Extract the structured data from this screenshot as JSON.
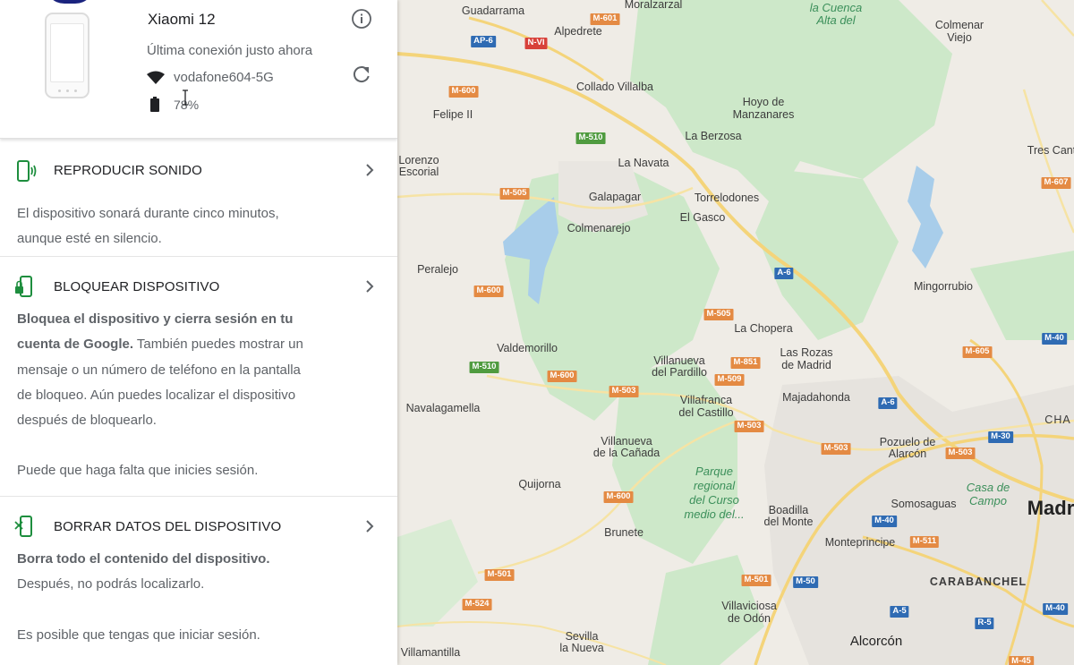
{
  "device": {
    "name": "Xiaomi 12",
    "last_connection": "Última conexión justo ahora",
    "wifi": "vodafone604-5G",
    "battery": "78%"
  },
  "actions": [
    {
      "title": "REPRODUCIR SONIDO",
      "lines": [
        "El dispositivo sonará durante cinco minutos,",
        "aunque esté en silencio."
      ]
    },
    {
      "title": "BLOQUEAR DISPOSITIVO",
      "bold_1": "Bloquea el dispositivo y cierra sesión en tu",
      "bold_2": "cuenta de Google.",
      "text_2": " También puedes mostrar un",
      "line_3": "mensaje o un número de teléfono en la pantalla",
      "line_4": "de bloqueo. Aún puedes localizar el dispositivo",
      "line_5": "después de bloquearlo.",
      "note": "Puede que haga falta que inicies sesión."
    },
    {
      "title": "BORRAR DATOS DEL DISPOSITIVO",
      "bold_1": "Borra todo el contenido del dispositivo.",
      "line_2": "Después, no podrás localizarlo.",
      "note": "Es posible que tengas que iniciar sesión."
    }
  ],
  "map": {
    "places": [
      "Guadarrama",
      "Moralzarzal",
      "Alpedrete",
      "Collado Villalba",
      "Felipe II",
      "Hoyo de",
      "Manzanares",
      "La Berzosa",
      "Tres Cant",
      "Lorenzo",
      "Escorial",
      "La Navata",
      "Galapagar",
      "Torrelodones",
      "Colmenarejo",
      "El Gasco",
      "Peralejo",
      "Mingorrubio",
      "La Chopera",
      "Valdemorillo",
      "Villanueva",
      "del Pardillo",
      "Las Rozas",
      "de Madrid",
      "Villafranca",
      "del Castillo",
      "Majadahonda",
      "Navalagamella",
      "Villanueva",
      "de la Cañada",
      "Pozuelo de",
      "Alarcón",
      "Quijorna",
      "Boadilla",
      "del Monte",
      "Somosaguas",
      "Madr",
      "Brunete",
      "Monteprincipe",
      "CARABANCHEL",
      "Villaviciosa",
      "de Odón",
      "Sevilla",
      "la Nueva",
      "Villamantilla",
      "Alcorcón",
      "Colmenar",
      "Viejo",
      "CHA"
    ],
    "parks": [
      "la Cuenca",
      "Alta del",
      "Parque",
      "regional",
      "del Curso",
      "medio del...",
      "Casa de",
      "Campo"
    ],
    "shields": [
      "M-601",
      "AP-6",
      "N-VI",
      "M-600",
      "M-510",
      "M-505",
      "A-6",
      "M-607",
      "M-600",
      "M-505",
      "M-40",
      "M-851",
      "M-509",
      "M-510",
      "M-600",
      "M-503",
      "M-605",
      "A-6",
      "M-503",
      "M-503",
      "M-503",
      "M-30",
      "M-600",
      "M-40",
      "M-501",
      "M-50",
      "M-511",
      "A-5",
      "R-5",
      "M-40",
      "M-501",
      "M-524",
      "M-45"
    ]
  }
}
